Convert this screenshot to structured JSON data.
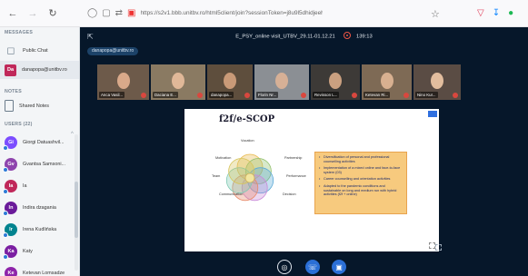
{
  "browser": {
    "url": "https://s2v1.bbb.unitbv.ro/html5client/join?sessionToken=j8u9l5dhidjeehdu",
    "url_domain": "unitbv.ro"
  },
  "sidebar": {
    "messages_title": "MESSAGES",
    "public_chat": "Public Chat",
    "my_user": {
      "initials": "Da",
      "name": "danapopa@unitbv.ro",
      "color": "#c0285a"
    },
    "notes_title": "NOTES",
    "shared_notes": "Shared Notes",
    "users_title": "USERS (22)",
    "users": [
      {
        "initials": "Gi",
        "name": "Giorgi Datuashvil...",
        "color": "#7c4dff"
      },
      {
        "initials": "Gv",
        "name": "Gvantsa Samsoni...",
        "color": "#8e44ad"
      },
      {
        "initials": "Ia",
        "name": "Ia",
        "color": "#c0285a"
      },
      {
        "initials": "In",
        "name": "Indira dzagania",
        "color": "#6a1b9a"
      },
      {
        "initials": "Ir",
        "name": "Irena Kudlińska",
        "color": "#00838f"
      },
      {
        "initials": "Ka",
        "name": "Katy",
        "color": "#7b1fa2"
      },
      {
        "initials": "Ke",
        "name": "Ketevan Lomsadze",
        "color": "#8e24aa"
      }
    ]
  },
  "conference": {
    "session_name": "E_PSY_online visit_UTBV_29.11-01.12.21",
    "timer": "139:13",
    "presenter_chip": "danapopa@unitbv.ro",
    "participants": [
      {
        "name": "Anca Vasil...",
        "bg": "#6d5a4a",
        "face": "#d9a98a"
      },
      {
        "name": "Daciana E...",
        "bg": "#8a7a62",
        "face": "#e0b898"
      },
      {
        "name": "danapopa...",
        "bg": "#5e4e3d",
        "face": "#c99a78"
      },
      {
        "name": "Florin Nr...",
        "bg": "#8b8f94",
        "face": "#d6b096"
      },
      {
        "name": "Revisson L...",
        "bg": "#3d3a37",
        "face": "#caa080"
      },
      {
        "name": "Ketevan Ri...",
        "bg": "#7e6a55",
        "face": "#d8b090"
      },
      {
        "name": "Nino Kur...",
        "bg": "#5a4c44",
        "face": "#e2bd9e"
      }
    ]
  },
  "slide": {
    "title": "f2f/e-SCOP",
    "petals": [
      "Vocation",
      "Motivation",
      "Partnership",
      "Team",
      "Performance",
      "Communication",
      "Decision"
    ],
    "points": [
      "Diversification of personal and professional counselling activities",
      "Implementation of a mixed online and face-to-face system (03)",
      "Career counselling and orientation activities",
      "Adapted to the pandemic conditions and sustainable on long and medium run with hybrid activities (f2f + online)"
    ]
  }
}
